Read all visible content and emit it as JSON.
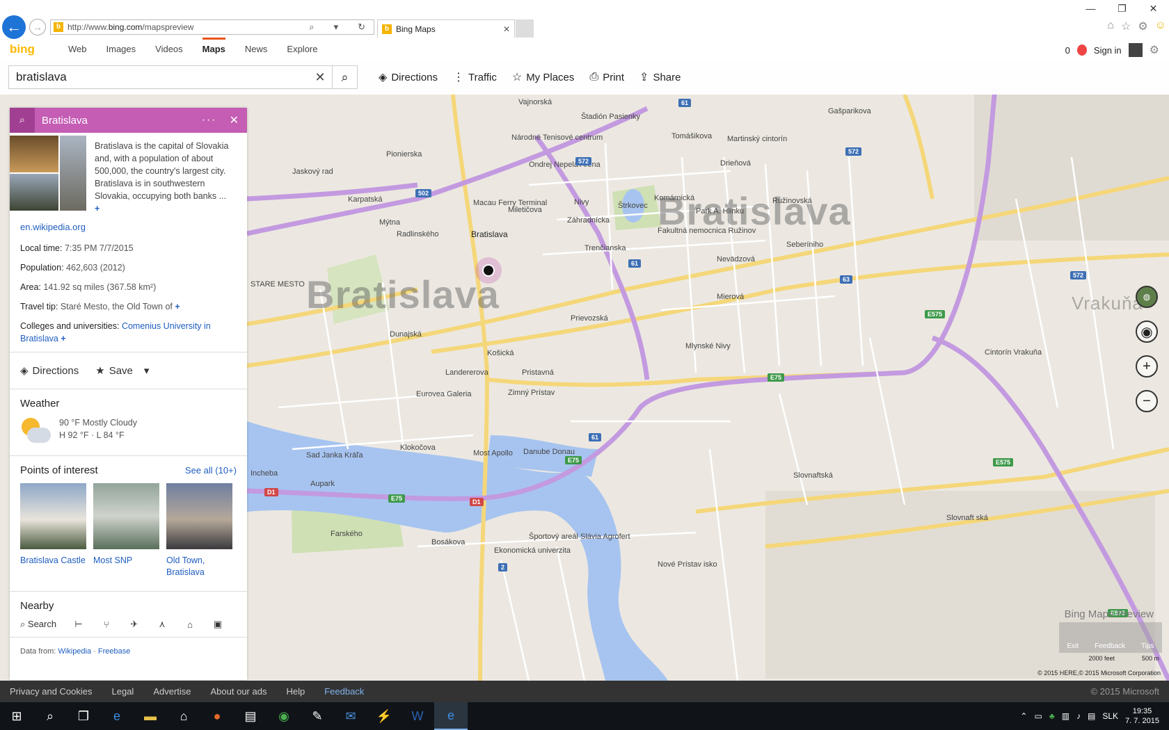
{
  "browser": {
    "url_prefix": "http://www.",
    "url_domain": "bing.com",
    "url_path": "/mapspreview",
    "tab_title": "Bing Maps"
  },
  "bing": {
    "logo": "bing",
    "nav": [
      "Web",
      "Images",
      "Videos",
      "Maps",
      "News",
      "Explore"
    ],
    "active_nav": "Maps",
    "rewards_count": "0",
    "sign_in": "Sign in"
  },
  "toolbar": {
    "search_value": "bratislava",
    "directions": "Directions",
    "traffic": "Traffic",
    "my_places": "My Places",
    "print": "Print",
    "share": "Share"
  },
  "panel": {
    "title": "Bratislava",
    "description": "Bratislava is the capital of Slovakia and, with a population of about 500,000, the country's largest city. Bratislava is in southwestern Slovakia, occupying both banks ...",
    "wiki_link": "en.wikipedia.org",
    "facts": {
      "local_time_label": "Local time:",
      "local_time_value": "7:35 PM 7/7/2015",
      "population_label": "Population:",
      "population_value": "462,603 (2012)",
      "area_label": "Area:",
      "area_value": "141.92 sq miles (367.58 km²)",
      "travel_label": "Travel tip:",
      "travel_value": "Staré Mesto, the Old Town of",
      "colleges_label": "Colleges and universities:",
      "colleges_value": "Comenius University in Bratislava"
    },
    "actions": {
      "directions": "Directions",
      "save": "Save"
    },
    "weather": {
      "heading": "Weather",
      "condition": "90 °F Mostly Cloudy",
      "high_low": "H 92 °F · L 84 °F"
    },
    "poi": {
      "heading": "Points of interest",
      "see_all": "See all (10+)",
      "items": [
        {
          "name": "Bratislava Castle",
          "color": "#8ea7c6"
        },
        {
          "name": "Most SNP",
          "color": "#93a59b"
        },
        {
          "name": "Old Town, Bratislava",
          "color": "#6f7fa0"
        }
      ]
    },
    "nearby": {
      "heading": "Nearby",
      "search": "Search"
    },
    "data_from": {
      "label": "Data from:",
      "wikipedia": "Wikipedia",
      "freebase": "Freebase"
    }
  },
  "map": {
    "city_label": "Bratislava",
    "big_names": [
      "Bratislava",
      "Bratislava",
      "Vrakuňa"
    ],
    "labels": [
      "Gašparikova",
      "Štadión Pasienky",
      "Národné Tenisové centrum",
      "Ondrej Nepela Aréna",
      "Tomášikova",
      "Martinský cintorín",
      "Drieňová",
      "Komárnická",
      "Park A. Hlinku",
      "Ružinovská",
      "Štrkovec",
      "Nivy",
      "Macau Ferry Terminal",
      "Miletičova",
      "Záhradnícka",
      "Trenčianska",
      "Fakultná nemocnica Ružinov",
      "Seberíniho",
      "Nevädzová",
      "Mierová",
      "Prievozská",
      "Mlynské Nivy",
      "Landererova",
      "Pristavná",
      "Eurovea Galeria",
      "Zimný Prístav",
      "Danube Donau",
      "Klokočova",
      "Sad Janka Kráľa",
      "Aupark",
      "Incheba",
      "Slovnaftská",
      "Slovnaft ská",
      "Cintorín Vrakuňa",
      "Bosákova",
      "Farského",
      "Ekonomická univerzita",
      "Športový areál Slávia Agrofert",
      "Nové Prístav isko",
      "STARE MESTO",
      "Dunajská",
      "Košická",
      "Most Apollo",
      "Karpatská",
      "Radlinského",
      "Mýtna",
      "Pionierska",
      "Jaskový rad",
      "Vajnorská"
    ],
    "shields": [
      "61",
      "572",
      "502",
      "61",
      "572",
      "63",
      "E575",
      "E75",
      "61",
      "E75",
      "E75",
      "D1",
      "D1",
      "2",
      "E575",
      "572",
      "E575"
    ],
    "branding": "Bing Maps Preview",
    "feedback_items": [
      "Exit",
      "Feedback",
      "Tips"
    ],
    "scale_feet": "2000 feet",
    "scale_m": "500 m",
    "copyright": "© 2015 HERE,© 2015 Microsoft Corporation"
  },
  "footer": {
    "links": [
      "Privacy and Cookies",
      "Legal",
      "Advertise",
      "About our ads",
      "Help"
    ],
    "feedback": "Feedback",
    "copyright": "© 2015 Microsoft"
  },
  "taskbar": {
    "language": "SLK",
    "time": "19:35",
    "date": "7. 7. 2015"
  },
  "colors": {
    "accent": "#c45db3",
    "link": "#1e5dbf",
    "road_major": "#f5d77a",
    "highway": "#c39ae0",
    "water": "#a7c4f0",
    "park": "#cfe0b4"
  }
}
